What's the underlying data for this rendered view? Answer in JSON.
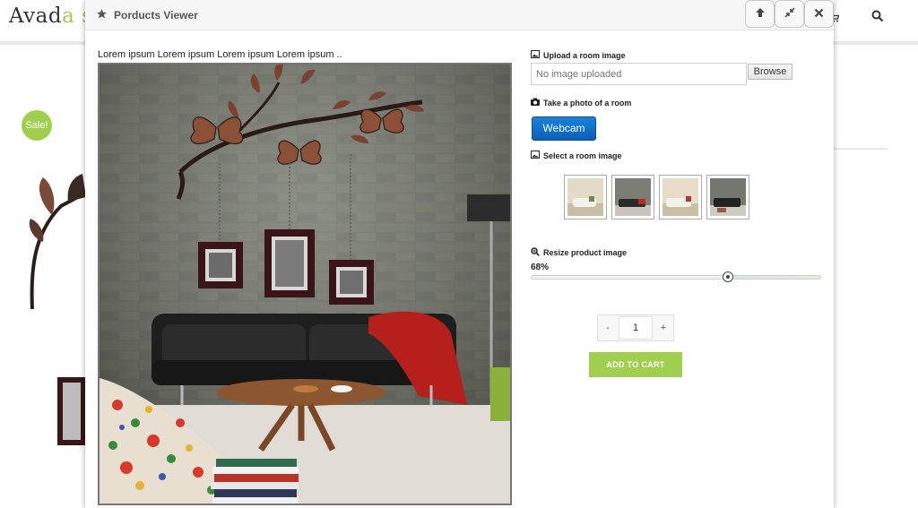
{
  "site": {
    "logo_main": "Avad",
    "logo_accent": "a s",
    "sale_badge": "Sale!",
    "icons": {
      "cart": "cart-icon",
      "search": "search-icon"
    }
  },
  "modal": {
    "title": "Porducts Viewer",
    "title_icon": "star-icon",
    "buttons": {
      "up": "arrow-up-icon",
      "minimize": "compress-icon",
      "close": "close-icon"
    },
    "product_caption": "Lorem ipsum Lorem ipsum Lorem ipsum Lorem ipsum ..",
    "upload": {
      "label": "Upload a room image",
      "placeholder": "No image uploaded",
      "browse_label": "Browse"
    },
    "webcam": {
      "label": "Take a photo of a room",
      "button_label": "Webcam"
    },
    "room_select": {
      "label": "Select a room image",
      "thumbnails": [
        "room-thumb-1",
        "room-thumb-2",
        "room-thumb-3",
        "room-thumb-4"
      ]
    },
    "resize": {
      "label": "Resize product image",
      "value_text": "68%",
      "value": 0.68
    },
    "quantity": {
      "minus": "-",
      "value": "1",
      "plus": "+"
    },
    "add_to_cart_label": "ADD TO CART",
    "colors": {
      "accent": "#a0ce4e",
      "webcam": "#1271c9"
    }
  }
}
